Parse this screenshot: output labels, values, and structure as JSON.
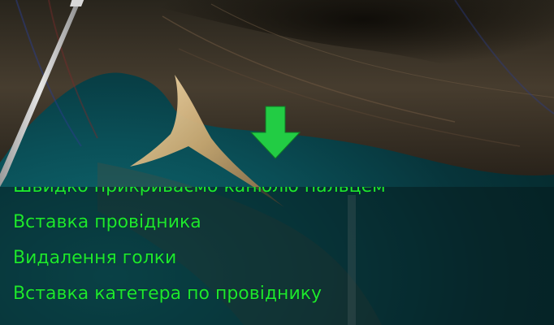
{
  "scene": {
    "indicator_icon": "down-arrow-icon",
    "indicator_color": "#22cc44",
    "background_color": "#0a4f57",
    "tissue_color": "#3a2f24"
  },
  "menu": {
    "text_color": "#1de82e",
    "items": [
      {
        "label": "Швидко прикриваємо канюлю пальцем",
        "partially_visible": true
      },
      {
        "label": "Вставка провідника"
      },
      {
        "label": "Видалення голки"
      },
      {
        "label": "Вставка катетера по провіднику"
      }
    ]
  }
}
